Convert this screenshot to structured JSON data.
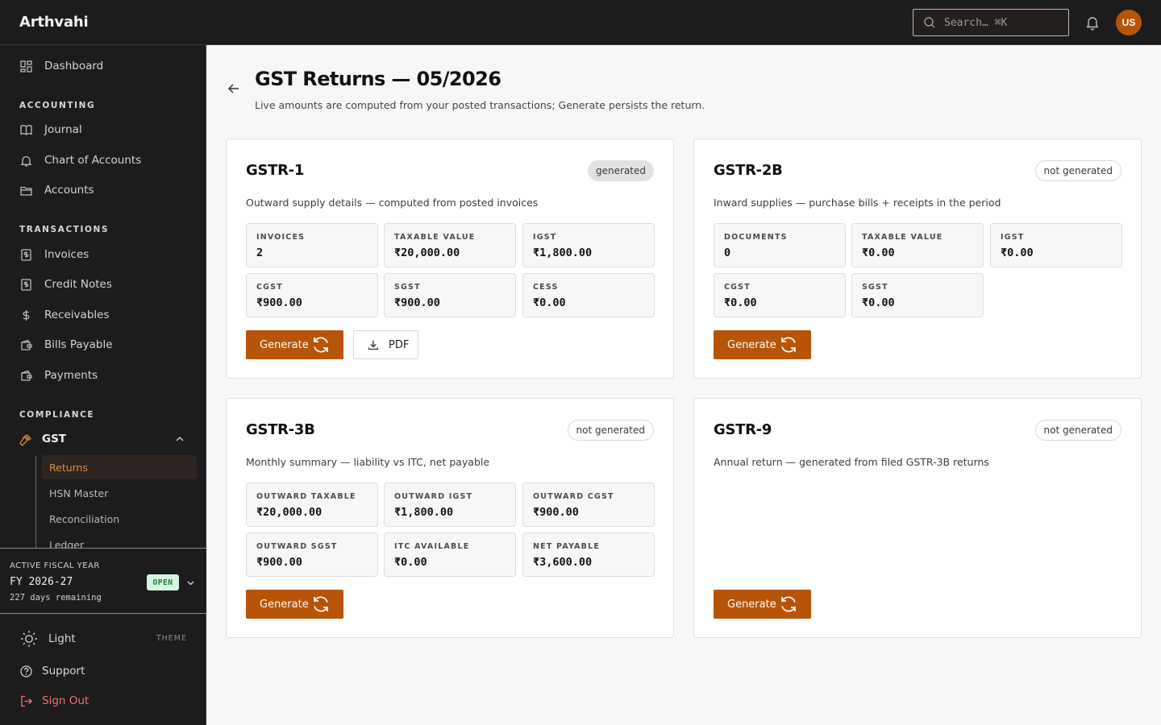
{
  "app": {
    "name": "Arthvahi",
    "avatar_initials": "US"
  },
  "search": {
    "placeholder": "Search… ⌘K"
  },
  "sidebar": {
    "dashboard": "Dashboard",
    "sections": {
      "accounting": "ACCOUNTING",
      "transactions": "TRANSACTIONS",
      "compliance": "COMPLIANCE"
    },
    "accounting_items": [
      "Journal",
      "Chart of Accounts",
      "Accounts"
    ],
    "transaction_items": [
      "Invoices",
      "Credit Notes",
      "Receivables",
      "Bills Payable",
      "Payments"
    ],
    "gst": {
      "label": "GST",
      "sub_items": [
        "Returns",
        "HSN Master",
        "Reconciliation",
        "Ledger"
      ],
      "active": "Returns"
    },
    "fiscal_year": {
      "label": "ACTIVE FISCAL YEAR",
      "value": "FY 2026-27",
      "badge": "OPEN",
      "remaining": "227 days remaining"
    },
    "theme": {
      "label": "Light",
      "tag": "THEME"
    },
    "support": "Support",
    "sign_out": "Sign Out"
  },
  "page": {
    "title": "GST Returns — 05/2026",
    "subtitle": "Live amounts are computed from your posted transactions; Generate persists the return."
  },
  "cards": [
    {
      "title": "GSTR-1",
      "status": "generated",
      "description": "Outward supply details — computed from posted invoices",
      "metrics": [
        {
          "label": "INVOICES",
          "value": "2"
        },
        {
          "label": "TAXABLE VALUE",
          "value": "₹20,000.00"
        },
        {
          "label": "IGST",
          "value": "₹1,800.00"
        },
        {
          "label": "CGST",
          "value": "₹900.00"
        },
        {
          "label": "SGST",
          "value": "₹900.00"
        },
        {
          "label": "CESS",
          "value": "₹0.00"
        }
      ],
      "generate_label": "Generate",
      "pdf_label": "PDF"
    },
    {
      "title": "GSTR-2B",
      "status": "not generated",
      "description": "Inward supplies — purchase bills + receipts in the period",
      "metrics": [
        {
          "label": "DOCUMENTS",
          "value": "0"
        },
        {
          "label": "TAXABLE VALUE",
          "value": "₹0.00"
        },
        {
          "label": "IGST",
          "value": "₹0.00"
        },
        {
          "label": "CGST",
          "value": "₹0.00"
        },
        {
          "label": "SGST",
          "value": "₹0.00"
        }
      ],
      "generate_label": "Generate"
    },
    {
      "title": "GSTR-3B",
      "status": "not generated",
      "description": "Monthly summary — liability vs ITC, net payable",
      "metrics": [
        {
          "label": "OUTWARD TAXABLE",
          "value": "₹20,000.00"
        },
        {
          "label": "OUTWARD IGST",
          "value": "₹1,800.00"
        },
        {
          "label": "OUTWARD CGST",
          "value": "₹900.00"
        },
        {
          "label": "OUTWARD SGST",
          "value": "₹900.00"
        },
        {
          "label": "ITC AVAILABLE",
          "value": "₹0.00"
        },
        {
          "label": "NET PAYABLE",
          "value": "₹3,600.00"
        }
      ],
      "generate_label": "Generate"
    },
    {
      "title": "GSTR-9",
      "status": "not generated",
      "description": "Annual return — generated from filed GSTR-3B returns",
      "metrics": [],
      "generate_label": "Generate"
    }
  ],
  "colors": {
    "accent": "#b85407",
    "sidebar_bg": "#1c1c1c",
    "active_text": "#e08a3c",
    "danger": "#f87171",
    "open_badge": "#15803d"
  }
}
